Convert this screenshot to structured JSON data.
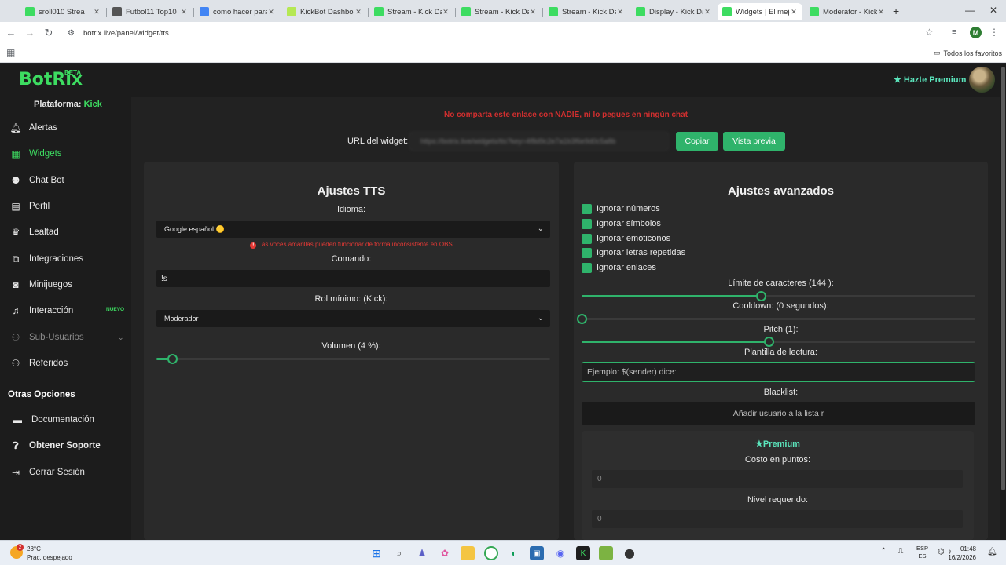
{
  "browser": {
    "tabs": [
      {
        "label": "sroll010 Strea",
        "color": "#3ddc61"
      },
      {
        "label": "Futbol11 Top10",
        "color": "#555555"
      },
      {
        "label": "como hacer para",
        "color": "#4285f4"
      },
      {
        "label": "KickBot Dashboa",
        "color": "#b5e853"
      },
      {
        "label": "Stream - Kick Da",
        "color": "#3ddc61"
      },
      {
        "label": "Stream - Kick Da",
        "color": "#3ddc61"
      },
      {
        "label": "Stream - Kick Da",
        "color": "#3ddc61"
      },
      {
        "label": "Display - Kick Da",
        "color": "#3ddc61"
      },
      {
        "label": "Widgets | El mejo",
        "color": "#3ddc61",
        "active": true
      },
      {
        "label": "Moderator - Kick",
        "color": "#3ddc61"
      }
    ],
    "url": "botrix.live/panel/widget/tts",
    "profile_initial": "M",
    "all_bookmarks": "Todos los favoritos"
  },
  "header": {
    "logo": "BotRix",
    "beta": "BETA",
    "premium_link": "Hazte Premium"
  },
  "sidebar": {
    "platform_label": "Plataforma:",
    "platform_value": "Kick",
    "items": [
      {
        "label": "Alertas",
        "icon": "bell-icon"
      },
      {
        "label": "Widgets",
        "icon": "widgets-icon",
        "active": true
      },
      {
        "label": "Chat Bot",
        "icon": "robot-icon"
      },
      {
        "label": "Perfil",
        "icon": "profile-card-icon"
      },
      {
        "label": "Lealtad",
        "icon": "trophy-icon"
      },
      {
        "label": "Integraciones",
        "icon": "integrations-icon"
      },
      {
        "label": "Minijuegos",
        "icon": "gamepad-icon"
      },
      {
        "label": "Interacción",
        "icon": "music-icon",
        "badge": "NUEVO"
      },
      {
        "label": "Sub-Usuarios",
        "icon": "users-gear-icon",
        "dim": true,
        "chevron": true
      },
      {
        "label": "Referidos",
        "icon": "users-icon"
      }
    ],
    "other_options_title": "Otras Opciones",
    "other_items": [
      {
        "label": "Documentación",
        "icon": "document-icon"
      },
      {
        "label": "Obtener Soporte",
        "icon": "help-icon",
        "bold": true
      },
      {
        "label": "Cerrar Sesión",
        "icon": "logout-icon"
      }
    ]
  },
  "main": {
    "warning": "No comparta este enlace con NADIE, ni lo pegues en ningún chat",
    "url_label": "URL del widget:",
    "url_value": "https://botrix.live/widgets/tts?key=4f8d9c2e7a1b3f6e9d0c5a8b",
    "copy_label": "Copiar",
    "preview_label": "Vista previa"
  },
  "tts": {
    "title": "Ajustes TTS",
    "language_label": "Idioma:",
    "language_value": "Google español 🟡",
    "voice_warning": "Las voces amarillas pueden funcionar de forma inconsistente en OBS",
    "command_label": "Comando:",
    "command_value": "!s",
    "role_label": "Rol mínimo: (Kick):",
    "role_value": "Moderador",
    "volume_label": "Volumen (4 %):",
    "volume_percent": 4
  },
  "advanced": {
    "title": "Ajustes avanzados",
    "checkboxes": [
      {
        "label": "Ignorar números",
        "checked": true
      },
      {
        "label": "Ignorar símbolos",
        "checked": true
      },
      {
        "label": "Ignorar emoticonos",
        "checked": true
      },
      {
        "label": "Ignorar letras repetidas",
        "checked": true
      },
      {
        "label": "Ignorar enlaces",
        "checked": true
      }
    ],
    "char_limit_label": "Límite de caracteres (144 ):",
    "char_limit_fraction": 0.455,
    "cooldown_label": "Cooldown: (0 segundos):",
    "cooldown_fraction": 0.0,
    "pitch_label": "Pitch (1):",
    "pitch_fraction": 0.475,
    "template_label": "Plantilla de lectura:",
    "template_placeholder": "Ejemplo: $(sender) dice:",
    "blacklist_label": "Blacklist:",
    "blacklist_placeholder": "Añadir usuario a la lista r",
    "premium_title": "Premium",
    "cost_label": "Costo en puntos:",
    "cost_value": "0",
    "level_label": "Nivel requerido:",
    "level_value": "0"
  },
  "taskbar": {
    "temp": "28°C",
    "weather": "Prac. despejado",
    "weather_badge": "2",
    "lang_top": "ESP",
    "lang_bottom": "ES",
    "time": "01:48",
    "date": "16/2/2026"
  }
}
